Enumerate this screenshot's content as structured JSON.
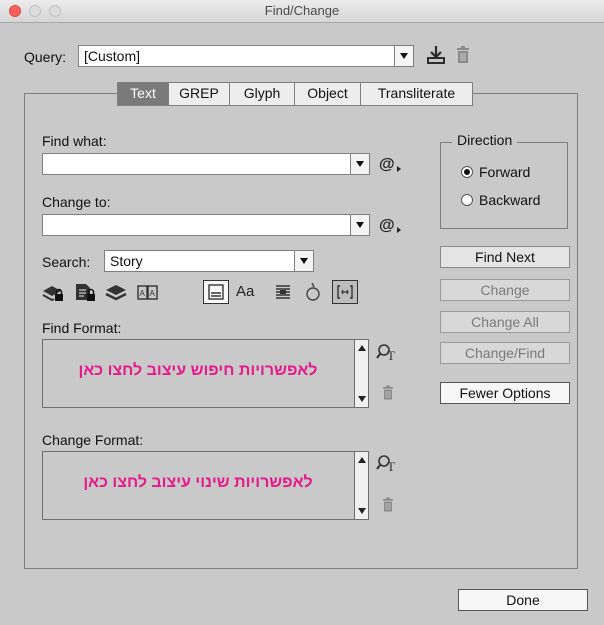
{
  "window": {
    "title": "Find/Change"
  },
  "query": {
    "label": "Query:",
    "value": "[Custom]",
    "save_icon": "save-query-icon",
    "delete_icon": "trash-icon"
  },
  "tabs": [
    {
      "label": "Text",
      "selected": true
    },
    {
      "label": "GREP",
      "selected": false
    },
    {
      "label": "Glyph",
      "selected": false
    },
    {
      "label": "Object",
      "selected": false
    },
    {
      "label": "Transliterate",
      "selected": false
    }
  ],
  "find": {
    "label": "Find what:",
    "value": "",
    "special_icon": "at-sign-menu-icon"
  },
  "change": {
    "label": "Change to:",
    "value": "",
    "special_icon": "at-sign-menu-icon"
  },
  "direction": {
    "title": "Direction",
    "options": [
      "Forward",
      "Backward"
    ],
    "selected": "Forward"
  },
  "search": {
    "label": "Search:",
    "value": "Story"
  },
  "toggle_icons": [
    "include-locked-layers-icon",
    "include-locked-stories-icon",
    "include-hidden-layers-icon",
    "include-master-pages-icon",
    "include-footnotes-icon",
    "case-sensitive-icon",
    "whole-word-icon",
    "kana-sensitive-icon",
    "full-half-width-icon"
  ],
  "case_sensitive_glyph": "Aa",
  "find_format": {
    "label": "Find Format:",
    "hint": "לאפשרויות חיפוש עיצוב לחצו כאן"
  },
  "change_format": {
    "label": "Change Format:",
    "hint": "לאפשרויות שינוי עיצוב לחצו כאן"
  },
  "buttons": {
    "find_next": "Find Next",
    "change": "Change",
    "change_all": "Change All",
    "change_find": "Change/Find",
    "fewer_options": "Fewer Options",
    "done": "Done"
  },
  "colors": {
    "accent_text": "#e6198a",
    "selected_tab": "#7a7a7a"
  }
}
